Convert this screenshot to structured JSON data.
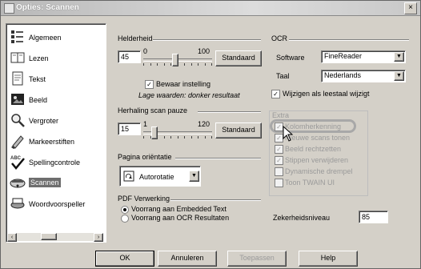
{
  "window": {
    "title": "Opties: Scannen",
    "close_glyph": "×"
  },
  "sidebar": {
    "items": [
      {
        "label": "Algemeen",
        "icon": "settings-list-icon"
      },
      {
        "label": "Lezen",
        "icon": "book-icon"
      },
      {
        "label": "Tekst",
        "icon": "text-document-icon"
      },
      {
        "label": "Beeld",
        "icon": "image-icon"
      },
      {
        "label": "Vergroter",
        "icon": "magnifier-icon"
      },
      {
        "label": "Markeerstiften",
        "icon": "highlighter-icon"
      },
      {
        "label": "Spellingcontrole",
        "icon": "spellcheck-icon"
      },
      {
        "label": "Scannen",
        "icon": "scanner-icon",
        "selected": true
      },
      {
        "label": "Woordvoorspeller",
        "icon": "word-prediction-icon"
      }
    ],
    "scroll_left": "‹",
    "scroll_right": "›"
  },
  "brightness": {
    "label": "Helderheid",
    "value": "45",
    "min": "0",
    "max": "100",
    "level": 0.45,
    "standard": "Standaard",
    "keep_label": "Bewaar instelling",
    "hint": "Lage waarden: donker resultaat"
  },
  "repeat": {
    "label": "Herhaling scan pauze",
    "value": "15",
    "min": "1",
    "max": "120",
    "level": 0.12,
    "standard": "Standaard"
  },
  "orientation": {
    "label": "Pagina oriëntatie",
    "value": "Autorotatie"
  },
  "pdf": {
    "label": "PDF Verwerking",
    "opt1": "Voorrang aan Embedded Text",
    "opt2": "Voorrang aan OCR Resultaten"
  },
  "ocr": {
    "label": "OCR",
    "software_label": "Software",
    "software_value": "FineReader",
    "language_label": "Taal",
    "language_value": "Nederlands",
    "change_label": "Wijzigen als leestaal wijzigt"
  },
  "extra": {
    "label": "Extra",
    "options": [
      {
        "label": "Kolomherkenning",
        "checked": true
      },
      {
        "label": "Nieuwe scans tonen",
        "checked": true
      },
      {
        "label": "Beeld rechtzetten",
        "checked": true
      },
      {
        "label": "Stippen verwijderen",
        "checked": true
      },
      {
        "label": "Dynamische drempel",
        "checked": false
      },
      {
        "label": "Toon TWAIN UI",
        "checked": false
      }
    ]
  },
  "confidence": {
    "label": "Zekerheidsniveau",
    "value": "85"
  },
  "buttons": {
    "ok": "OK",
    "cancel": "Annuleren",
    "apply": "Toepassen",
    "help": "Help"
  },
  "colors": {
    "face": "#d4d0c8",
    "highlight_ring": "#a8a8a8"
  }
}
